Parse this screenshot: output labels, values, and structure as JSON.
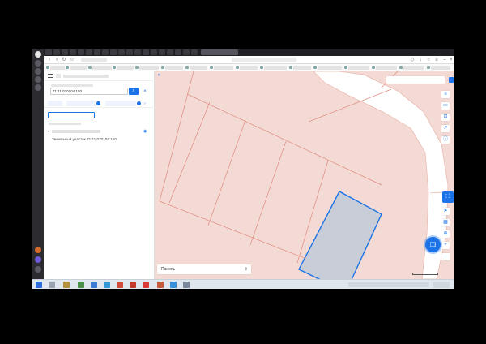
{
  "browser": {
    "tab_title": "",
    "url": "",
    "page_heading": ""
  },
  "search": {
    "label": "",
    "value": "71:11:070104:150",
    "placeholder": ""
  },
  "results": {
    "item_text": "Земельный участок 71:11:070104:150"
  },
  "map": {
    "layer_select": "Панель"
  },
  "colors": {
    "accent": "#1a73e8",
    "parcel_fill": "#c9cdd8",
    "parcel_stroke": "#1a73e8",
    "boundary": "#e08a7e",
    "map_background": "#f4dad4",
    "road": "#ffffff"
  },
  "icons": {
    "search": "search-icon",
    "clear": "close-icon",
    "pin": "pin-icon",
    "collapse": "collapse-icon",
    "chat": "chat-icon"
  }
}
